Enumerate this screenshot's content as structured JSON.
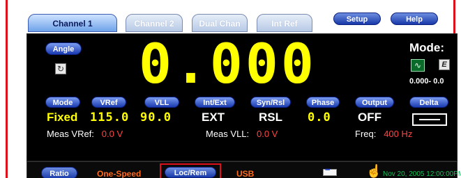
{
  "tabs": [
    {
      "label": "Channel 1",
      "active": true
    },
    {
      "label": "Channel 2",
      "active": false
    },
    {
      "label": "Dual Chan",
      "active": false
    },
    {
      "label": "Int Ref",
      "active": false
    }
  ],
  "toolbar": {
    "setup_label": "Setup",
    "help_label": "Help"
  },
  "display": {
    "angle_label": "Angle",
    "reading": "0.000",
    "mode_label": "Mode:",
    "mode_icons": [
      "sine-wave-icon",
      "e-icon"
    ],
    "range_text": "0.000-   0.0"
  },
  "buttons": {
    "mode": "Mode",
    "vref": "VRef",
    "vll": "VLL",
    "intext": "Int/Ext",
    "synrsl": "Syn/Rsl",
    "phase": "Phase",
    "output": "Output",
    "delta": "Delta"
  },
  "values": {
    "mode": "Fixed",
    "vref": "115.0",
    "vll": "90.0",
    "intext": "EXT",
    "synrsl": "RSL",
    "phase": "0.0",
    "output": "OFF"
  },
  "measurements": {
    "vref_label": "Meas VRef:",
    "vref_value": "0.0 V",
    "vll_label": "Meas VLL:",
    "vll_value": "0.0 V",
    "freq_label": "Freq:",
    "freq_value": "400 Hz"
  },
  "status": {
    "ratio_label": "Ratio",
    "speed": "One-Speed",
    "locrem_label": "Loc/Rem",
    "interface": "USB",
    "timestamp": "Nov 20, 2005 12:00:00PM"
  },
  "colors": {
    "digits": "#ffff00",
    "accent_blue": "#1738a8",
    "status_orange": "#ff6a1a",
    "meas_red": "#ff4444",
    "time_green": "#12c15a",
    "highlight_red": "#e0101a"
  }
}
